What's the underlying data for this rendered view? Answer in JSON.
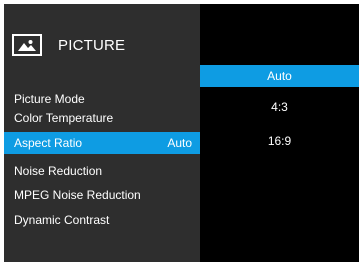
{
  "header": {
    "title": "PICTURE",
    "icon": "picture-icon"
  },
  "menu": {
    "items": [
      {
        "label": "Picture Mode",
        "value": ""
      },
      {
        "label": "Color Temperature",
        "value": ""
      },
      {
        "label": "Aspect Ratio",
        "value": "Auto"
      },
      {
        "label": "Noise Reduction",
        "value": ""
      },
      {
        "label": "MPEG Noise Reduction",
        "value": ""
      },
      {
        "label": "Dynamic Contrast",
        "value": ""
      }
    ],
    "selected_index": 2
  },
  "options": {
    "items": [
      "Auto",
      "4:3",
      "16:9"
    ],
    "selected_index": 0
  },
  "colors": {
    "accent": "#0e9ce3",
    "panel": "#2e2e2e",
    "background": "#000000",
    "text": "#ffffff"
  }
}
